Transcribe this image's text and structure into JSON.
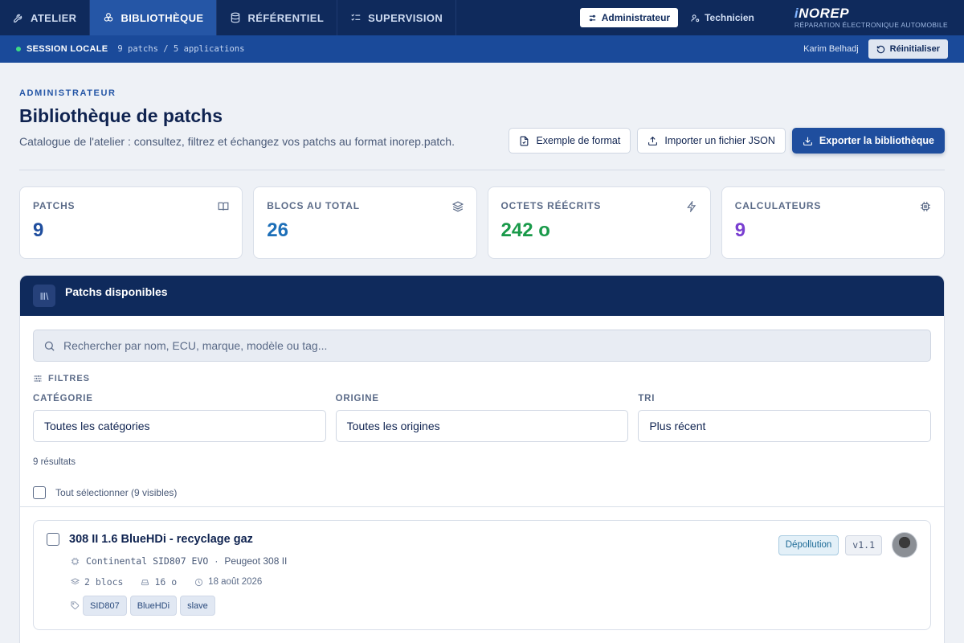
{
  "nav": {
    "tabs": [
      {
        "label": "ATELIER",
        "icon": "wrench-icon"
      },
      {
        "label": "BIBLIOTHÈQUE",
        "icon": "library-icon"
      },
      {
        "label": "RÉFÉRENTIEL",
        "icon": "database-icon"
      },
      {
        "label": "SUPERVISION",
        "icon": "checklist-icon"
      }
    ],
    "active_tab": "BIBLIOTHÈQUE",
    "roles": {
      "admin": "Administrateur",
      "tech": "Technicien",
      "active": "Administrateur"
    },
    "brand": {
      "name_i": "i",
      "name_rest": "NOREP",
      "subtitle": "RÉPARATION ÉLECTRONIQUE AUTOMOBILE"
    }
  },
  "session": {
    "label": "SESSION LOCALE",
    "meta": "9 patchs / 5 applications",
    "user": "Karim Belhadj",
    "reset": "Réinitialiser"
  },
  "header": {
    "eyebrow": "ADMINISTRATEUR",
    "title": "Bibliothèque de patchs",
    "subtitle": "Catalogue de l'atelier : consultez, filtrez et échangez vos patchs au format inorep.patch.",
    "actions": {
      "example": "Exemple de format",
      "import": "Importer un fichier JSON",
      "export": "Exporter la bibliothèque"
    }
  },
  "stats": [
    {
      "label": "PATCHS",
      "value": "9",
      "icon": "book-icon"
    },
    {
      "label": "BLOCS AU TOTAL",
      "value": "26",
      "icon": "layers-icon"
    },
    {
      "label": "OCTETS RÉÉCRITS",
      "value": "242 o",
      "icon": "bolt-icon"
    },
    {
      "label": "CALCULATEURS",
      "value": "9",
      "icon": "chip-icon"
    }
  ],
  "panel": {
    "title": "Patchs disponibles",
    "search_placeholder": "Rechercher par nom, ECU, marque, modèle ou tag...",
    "filters_label": "FILTRES",
    "filters": {
      "category": {
        "label": "CATÉGORIE",
        "value": "Toutes les catégories"
      },
      "origin": {
        "label": "ORIGINE",
        "value": "Toutes les origines"
      },
      "sort": {
        "label": "TRI",
        "value": "Plus récent"
      }
    },
    "results": "9 résultats",
    "select_all": "Tout sélectionner (9 visibles)"
  },
  "patches": [
    {
      "title": "308 II 1.6 BlueHDi - recyclage gaz",
      "ecu": "Continental SID807 EVO",
      "vehicle": "Peugeot 308 II",
      "blocks": "2 blocs",
      "bytes": "16 o",
      "date": "18 août 2026",
      "category": "Dépollution",
      "version": "v1.1",
      "tags": [
        "SID807",
        "BlueHDi",
        "slave"
      ]
    }
  ],
  "colors": {
    "nav": "#0f2a5c",
    "session": "#1a4a9a",
    "accent": "#1f4e9e",
    "green": "#1a9a4a",
    "purple": "#7a3fd1"
  }
}
